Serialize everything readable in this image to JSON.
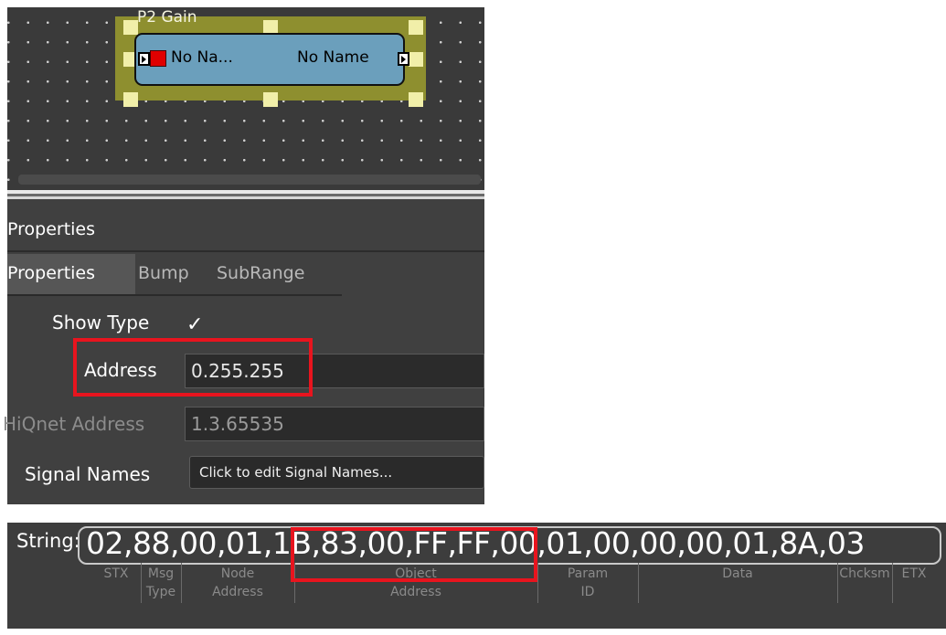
{
  "block": {
    "title": "P2  Gain",
    "input_signal": "No Na...",
    "output_signal": "No Name"
  },
  "panel": {
    "title": "Properties",
    "tabs": [
      "Properties",
      "Bump",
      "SubRange"
    ],
    "active_tab": "Properties",
    "show_type": {
      "label": "Show Type",
      "checked": true,
      "check_glyph": "✓"
    },
    "address": {
      "label": "Address",
      "value": "0.255.255"
    },
    "hiqnet": {
      "label": "HiQnet Address",
      "value": "1.3.65535",
      "disabled": true
    },
    "signal_names": {
      "label": "Signal Names",
      "button": "Click to edit Signal Names..."
    }
  },
  "message": {
    "label": "String:",
    "value": "02,88,00,01,1B,83,00,FF,FF,00,01,00,00,00,01,8A,03",
    "segments": [
      [
        "STX"
      ],
      [
        "Msg",
        "Type"
      ],
      [
        "Node",
        "Address"
      ],
      [
        "Object",
        "Address"
      ],
      [
        "Param",
        "ID"
      ],
      [
        "Data"
      ],
      [
        "Chcksm"
      ],
      [
        "ETX"
      ]
    ]
  },
  "colors": {
    "highlight": "#e8141e",
    "block_fill": "#6b9fbc",
    "selection_frame": "#8e8f2f"
  }
}
